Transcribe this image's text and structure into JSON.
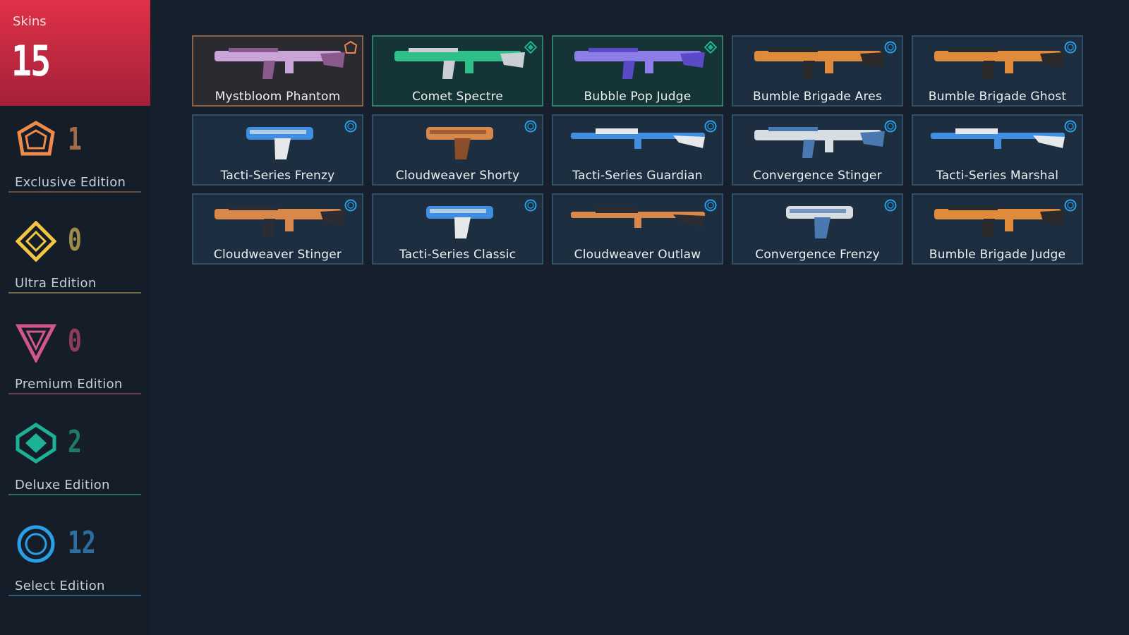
{
  "summary": {
    "title": "Skins",
    "count": "15"
  },
  "tiers": [
    {
      "label": "Exclusive Edition",
      "count": "1",
      "icon": "exclusive-pentagon-icon",
      "color": "#f08a4b",
      "line": "#6b4a3e"
    },
    {
      "label": "Ultra Edition",
      "count": "0",
      "icon": "ultra-diamond-icon",
      "color": "#f4c542",
      "line": "#6f6a4a"
    },
    {
      "label": "Premium Edition",
      "count": "0",
      "icon": "premium-triangle-icon",
      "color": "#d0568d",
      "line": "#6b3a56"
    },
    {
      "label": "Deluxe Edition",
      "count": "2",
      "icon": "deluxe-diamond-icon",
      "color": "#1bb295",
      "line": "#2b6a62"
    },
    {
      "label": "Select Edition",
      "count": "12",
      "icon": "select-circle-icon",
      "color": "#2a9ee6",
      "line": "#2c5c82"
    }
  ],
  "skins": [
    {
      "name": "Mystbloom Phantom",
      "tier": "exclusive",
      "colors": [
        "#c8a4d8",
        "#8a5a8c"
      ]
    },
    {
      "name": "Comet Spectre",
      "tier": "deluxe",
      "colors": [
        "#2fc08a",
        "#c9cfd4"
      ]
    },
    {
      "name": "Bubble Pop Judge",
      "tier": "deluxe",
      "colors": [
        "#8c7ee6",
        "#5a4ac8"
      ]
    },
    {
      "name": "Bumble Brigade Ares",
      "tier": "select",
      "colors": [
        "#e08a3c",
        "#2a2a2a"
      ]
    },
    {
      "name": "Bumble Brigade Ghost",
      "tier": "select",
      "colors": [
        "#e08a3c",
        "#2a2a2a"
      ]
    },
    {
      "name": "Tacti-Series Frenzy",
      "tier": "select",
      "colors": [
        "#3f8ee0",
        "#e6e8ea"
      ]
    },
    {
      "name": "Cloudweaver Shorty",
      "tier": "select",
      "colors": [
        "#d8884a",
        "#8a4e2a"
      ]
    },
    {
      "name": "Tacti-Series Guardian",
      "tier": "select",
      "colors": [
        "#3f8ee0",
        "#e6e8ea"
      ]
    },
    {
      "name": "Convergence Stinger",
      "tier": "select",
      "colors": [
        "#d8dde2",
        "#4a78b0"
      ]
    },
    {
      "name": "Tacti-Series Marshal",
      "tier": "select",
      "colors": [
        "#3f8ee0",
        "#e6e8ea"
      ]
    },
    {
      "name": "Cloudweaver Stinger",
      "tier": "select",
      "colors": [
        "#d8884a",
        "#2c2c34"
      ]
    },
    {
      "name": "Tacti-Series Classic",
      "tier": "select",
      "colors": [
        "#3f8ee0",
        "#e6e8ea"
      ]
    },
    {
      "name": "Cloudweaver Outlaw",
      "tier": "select",
      "colors": [
        "#d8884a",
        "#2c2c34"
      ]
    },
    {
      "name": "Convergence Frenzy",
      "tier": "select",
      "colors": [
        "#d8dde2",
        "#4a78b0"
      ]
    },
    {
      "name": "Bumble Brigade Judge",
      "tier": "select",
      "colors": [
        "#e08a3c",
        "#2a2a2a"
      ]
    }
  ]
}
